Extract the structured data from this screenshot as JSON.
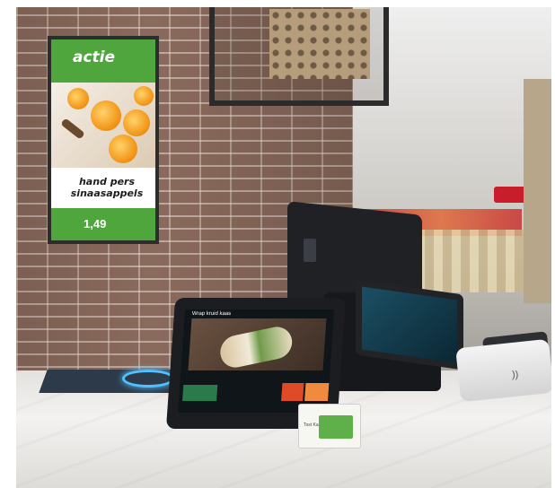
{
  "signage": {
    "logo": "actie",
    "headline_line1": "hand pers",
    "headline_line2": "sinaasappels",
    "price": "1,49",
    "brand_green": "#4fa63d"
  },
  "tablet": {
    "title": "Wrap kruid kaas",
    "left_button": "",
    "right_button_1": "",
    "right_button_2": ""
  },
  "customer_display": {
    "label": ""
  },
  "price_card": {
    "label": "Tost Kaasbroodje"
  },
  "colors": {
    "wall": "#8a6a5c",
    "counter": "#eceae7",
    "terminal": "#1f2125",
    "scanner_glow": "#51c2ff"
  },
  "icons": [
    "contactless-icon"
  ]
}
